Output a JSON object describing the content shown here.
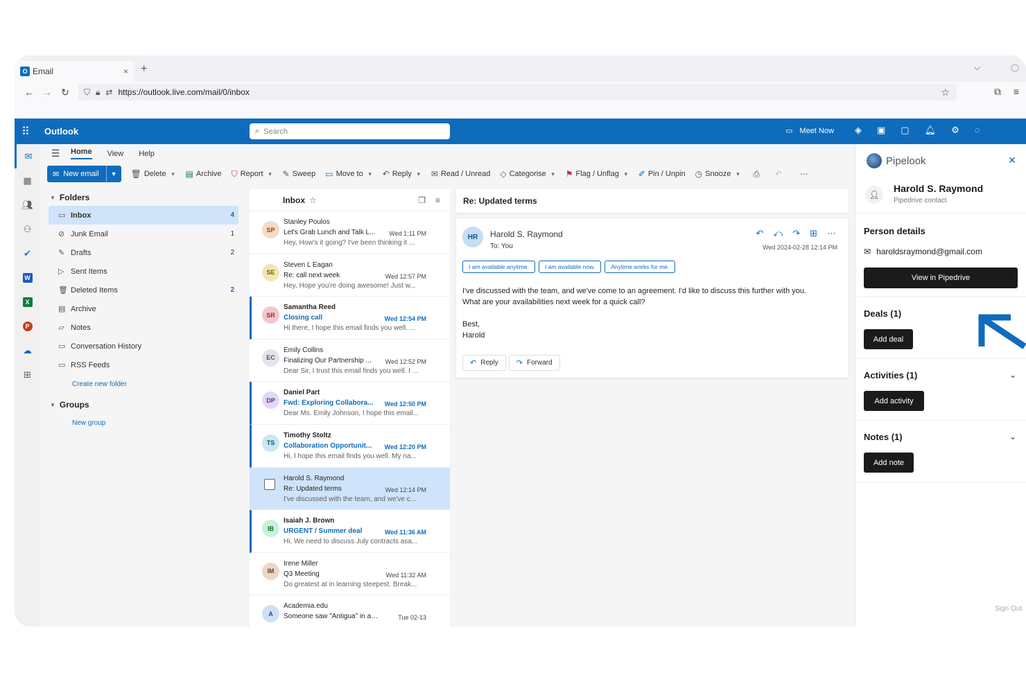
{
  "browser": {
    "tab_title": "Email",
    "tab_close": "×",
    "new_tab": "+",
    "url": "https://outlook.live.com/mail/0/inbox"
  },
  "app": {
    "name": "Outlook",
    "search_placeholder": "Search",
    "meet_now": "Meet Now",
    "accent_color": "#0f6cbd"
  },
  "ribbon": {
    "tabs": [
      "Home",
      "View",
      "Help"
    ],
    "new_email": "New email",
    "buttons": {
      "delete": "Delete",
      "archive": "Archive",
      "report": "Report",
      "sweep": "Sweep",
      "move_to": "Move to",
      "reply": "Reply",
      "read_unread": "Read / Unread",
      "categorise": "Categorise",
      "flag": "Flag / Unflag",
      "pin": "Pin / Unpin",
      "snooze": "Snooze"
    }
  },
  "folders": {
    "header": "Folders",
    "items": [
      {
        "name": "Inbox",
        "count": "4",
        "icon": "inbox-icon"
      },
      {
        "name": "Junk Email",
        "count": "1",
        "icon": "junk-icon"
      },
      {
        "name": "Drafts",
        "count": "2",
        "icon": "drafts-icon"
      },
      {
        "name": "Sent Items",
        "count": "",
        "icon": "sent-icon"
      },
      {
        "name": "Deleted Items",
        "count": "2",
        "icon": "trash-icon"
      },
      {
        "name": "Archive",
        "count": "",
        "icon": "archive-icon"
      },
      {
        "name": "Notes",
        "count": "",
        "icon": "notes-icon"
      },
      {
        "name": "Conversation History",
        "count": "",
        "icon": "folder-icon"
      },
      {
        "name": "RSS Feeds",
        "count": "",
        "icon": "folder-icon"
      }
    ],
    "create_folder": "Create new folder",
    "groups_header": "Groups",
    "new_group": "New group"
  },
  "maillist": {
    "title": "Inbox",
    "messages": [
      {
        "initials": "SP",
        "color": "#f7d9c4",
        "fg": "#8a4b1f",
        "sender": "Stanley Poulos",
        "subject": "Let's Grab Lunch and Talk L...",
        "time": "Wed 1:11 PM",
        "preview": "Hey, How's it going? I've been thinking it ..."
      },
      {
        "initials": "SE",
        "color": "#f3e6b4",
        "fg": "#7a5d00",
        "sender": "Steven L Eagan",
        "subject": "Re: call next week",
        "time": "Wed 12:57 PM",
        "preview": "Hey, Hope you're doing awesome! Just w..."
      },
      {
        "initials": "SR",
        "color": "#f4c6cc",
        "fg": "#a4262c",
        "sender": "Samantha Reed",
        "subject": "Closing call",
        "time": "Wed 12:54 PM",
        "preview": "Hi there, I hope this email finds you well. ..."
      },
      {
        "initials": "EC",
        "color": "#e1e5e9",
        "fg": "#555555",
        "sender": "Emily Collins",
        "subject": "Finalizing Our Partnership ...",
        "time": "Wed 12:52 PM",
        "preview": "Dear Sir, I trust this email finds you well. I ..."
      },
      {
        "initials": "DP",
        "color": "#e3d7f5",
        "fg": "#5c2e91",
        "sender": "Daniel Part",
        "subject": "Fwd: Exploring Collabora...",
        "time": "Wed 12:50 PM",
        "preview": "Dear Ms. Emily Johnson, I hope this email..."
      },
      {
        "initials": "TS",
        "color": "#cde6f2",
        "fg": "#005b70",
        "sender": "Timothy Stoltz",
        "subject": "Collaboration Opportunit...",
        "time": "Wed 12:20 PM",
        "preview": "Hi, I hope this email finds you well. My na..."
      },
      {
        "initials": "",
        "color": "",
        "fg": "",
        "sender": "Harold S. Raymond",
        "subject": "Re: Updated terms",
        "time": "Wed 12:14 PM",
        "preview": "I've discussed with the team, and we've c..."
      },
      {
        "initials": "IB",
        "color": "#c8f0dc",
        "fg": "#0b6a0b",
        "sender": "Isaiah J. Brown",
        "subject": "URGENT / Summer deal",
        "time": "Wed 11:36 AM",
        "preview": "Hi, We need to discuss July contracts asa..."
      },
      {
        "initials": "IM",
        "color": "#ecd8c8",
        "fg": "#6b3d1e",
        "sender": "Irene Miller",
        "subject": "Q3 Meeting",
        "time": "Wed 11:32 AM",
        "preview": "Do greatest at in learning steepest. Break..."
      },
      {
        "initials": "A",
        "color": "#cfe0f5",
        "fg": "#0f548c",
        "sender": "Academia.edu",
        "subject": "Someone saw \"Antigua\" in an ...",
        "time": "Tue 02-13",
        "preview": ""
      }
    ]
  },
  "reading": {
    "subject": "Re: Updated terms",
    "from_initials": "HR",
    "from": "Harold S. Raymond",
    "to": "To:  You",
    "date": "Wed 2024-02-28 12:14 PM",
    "suggestions": [
      "I am available anytime.",
      "I am available now.",
      "Anytime works for me."
    ],
    "body_line1": "I've discussed with the team, and we've come to an agreement. I'd like to discuss this further with you.",
    "body_line2": "What are your availabilities next week for a quick call?",
    "sign1": "Best,",
    "sign2": "Harold",
    "reply": "Reply",
    "forward": "Forward"
  },
  "pipelook": {
    "name": "Pipelook",
    "contact_name": "Harold S. Raymond",
    "contact_sub": "Pipedrive contact",
    "person_details": "Person details",
    "email": "haroldsraymond@gmail.com",
    "view_button": "View in Pipedrive",
    "deals": "Deals (1)",
    "add_deal": "Add deal",
    "activities": "Activities (1)",
    "add_activity": "Add activity",
    "notes": "Notes (1)",
    "add_note": "Add note",
    "sign_out": "Sign Out"
  }
}
